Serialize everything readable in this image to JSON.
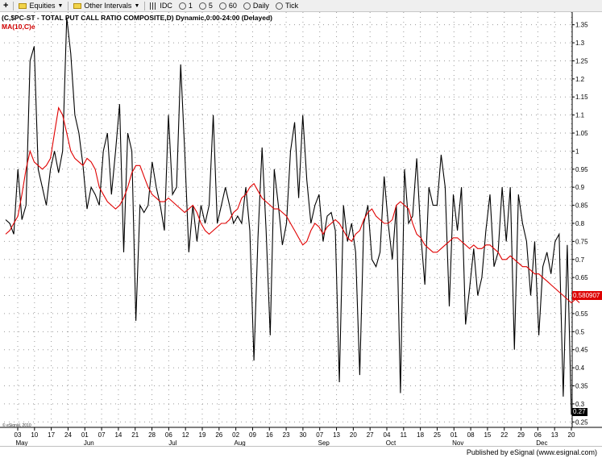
{
  "toolbar": {
    "items": [
      {
        "label": "Equities",
        "icon": "folder-icon",
        "dropdown": true
      },
      {
        "label": "Other Intervals",
        "icon": "folder-icon",
        "dropdown": true
      },
      {
        "label": "IDC",
        "icon": "interval-icon"
      },
      {
        "label": "1",
        "icon": "interval-icon"
      },
      {
        "label": "5",
        "icon": "interval-icon"
      },
      {
        "label": "60",
        "icon": "interval-icon"
      },
      {
        "label": "Daily",
        "icon": "interval-icon"
      },
      {
        "label": "Tick",
        "icon": "interval-icon"
      }
    ]
  },
  "footer": {
    "credit": "Published by eSignal (www.esignal.com)"
  },
  "watermark": "© eSignal, 2010",
  "chart_data": {
    "type": "line",
    "title": "(C,$PC-ST - TOTAL PUT CALL RATIO COMPOSITE,D) Dynamic,0:00-24:00 (Delayed)",
    "ma_label": "MA(10,C)e",
    "colors": {
      "price": "#000000",
      "ma": "#e00000",
      "grid": "#9a9a9a"
    },
    "ylim": [
      0.235,
      1.385
    ],
    "y_ticks": [
      0.25,
      0.3,
      0.35,
      0.4,
      0.45,
      0.5,
      0.55,
      0.6,
      0.65,
      0.7,
      0.75,
      0.8,
      0.85,
      0.9,
      0.95,
      1,
      1.05,
      1.1,
      1.15,
      1.2,
      1.25,
      1.3,
      1.35
    ],
    "x_tick_labels": [
      "03",
      "10",
      "17",
      "24",
      "01",
      "07",
      "14",
      "21",
      "28",
      "06",
      "12",
      "19",
      "26",
      "02",
      "09",
      "16",
      "23",
      "30",
      "07",
      "13",
      "20",
      "27",
      "04",
      "11",
      "18",
      "25",
      "01",
      "08",
      "15",
      "22",
      "29",
      "06",
      "13",
      "20"
    ],
    "month_labels": [
      {
        "label": "May",
        "tick": 0
      },
      {
        "label": "Jun",
        "tick": 4
      },
      {
        "label": "Jul",
        "tick": 9
      },
      {
        "label": "Aug",
        "tick": 13
      },
      {
        "label": "Sep",
        "tick": 18
      },
      {
        "label": "Oct",
        "tick": 22
      },
      {
        "label": "Nov",
        "tick": 26
      },
      {
        "label": "Dec",
        "tick": 31
      }
    ],
    "last_value_labels": {
      "ma": "0.580907",
      "close": "0.27"
    },
    "series": [
      {
        "name": "Close",
        "values": [
          0.81,
          0.8,
          0.77,
          0.95,
          0.81,
          0.85,
          1.25,
          1.29,
          0.95,
          0.9,
          0.85,
          0.95,
          1,
          0.94,
          1,
          1.37,
          1.27,
          1.1,
          1.05,
          0.96,
          0.84,
          0.9,
          0.88,
          0.85,
          1,
          1.05,
          0.88,
          1,
          1.13,
          0.72,
          1.05,
          1,
          0.53,
          0.85,
          0.83,
          0.85,
          0.97,
          0.9,
          0.85,
          0.78,
          1.1,
          0.88,
          0.9,
          1.24,
          1,
          0.72,
          0.85,
          0.75,
          0.85,
          0.8,
          0.85,
          1.1,
          0.8,
          0.85,
          0.9,
          0.85,
          0.8,
          0.82,
          0.8,
          0.9,
          0.78,
          0.42,
          0.76,
          1.01,
          0.78,
          0.49,
          0.95,
          0.85,
          0.74,
          0.8,
          1,
          1.08,
          0.87,
          1.1,
          0.92,
          0.8,
          0.85,
          0.88,
          0.75,
          0.82,
          0.83,
          0.78,
          0.36,
          0.85,
          0.75,
          0.8,
          0.72,
          0.38,
          0.8,
          0.85,
          0.7,
          0.68,
          0.72,
          0.93,
          0.8,
          0.7,
          0.85,
          0.33,
          0.95,
          0.8,
          0.82,
          0.98,
          0.77,
          0.63,
          0.9,
          0.85,
          0.85,
          0.99,
          0.9,
          0.57,
          0.88,
          0.78,
          0.9,
          0.52,
          0.62,
          0.73,
          0.6,
          0.65,
          0.78,
          0.88,
          0.68,
          0.72,
          0.9,
          0.75,
          0.9,
          0.45,
          0.88,
          0.8,
          0.75,
          0.6,
          0.75,
          0.49,
          0.68,
          0.72,
          0.66,
          0.75,
          0.77,
          0.32,
          0.74,
          0.27
        ]
      },
      {
        "name": "MA(10,C)e",
        "values": [
          0.77,
          0.78,
          0.8,
          0.82,
          0.88,
          0.95,
          1,
          0.97,
          0.96,
          0.95,
          0.96,
          0.98,
          1.05,
          1.12,
          1.1,
          1.05,
          1,
          0.98,
          0.97,
          0.96,
          0.98,
          0.97,
          0.95,
          0.9,
          0.88,
          0.86,
          0.85,
          0.84,
          0.85,
          0.87,
          0.9,
          0.94,
          0.96,
          0.96,
          0.93,
          0.9,
          0.88,
          0.87,
          0.86,
          0.86,
          0.87,
          0.86,
          0.85,
          0.84,
          0.83,
          0.84,
          0.85,
          0.83,
          0.8,
          0.78,
          0.77,
          0.78,
          0.79,
          0.8,
          0.8,
          0.81,
          0.83,
          0.84,
          0.87,
          0.88,
          0.9,
          0.91,
          0.89,
          0.87,
          0.86,
          0.85,
          0.84,
          0.84,
          0.83,
          0.82,
          0.8,
          0.78,
          0.76,
          0.74,
          0.75,
          0.78,
          0.8,
          0.79,
          0.77,
          0.79,
          0.8,
          0.81,
          0.8,
          0.78,
          0.76,
          0.75,
          0.77,
          0.78,
          0.81,
          0.83,
          0.84,
          0.82,
          0.81,
          0.8,
          0.8,
          0.81,
          0.85,
          0.86,
          0.85,
          0.84,
          0.8,
          0.77,
          0.76,
          0.74,
          0.73,
          0.72,
          0.72,
          0.73,
          0.74,
          0.75,
          0.76,
          0.76,
          0.75,
          0.74,
          0.73,
          0.74,
          0.73,
          0.73,
          0.74,
          0.74,
          0.73,
          0.72,
          0.7,
          0.7,
          0.71,
          0.7,
          0.69,
          0.68,
          0.68,
          0.67,
          0.66,
          0.66,
          0.65,
          0.64,
          0.63,
          0.62,
          0.61,
          0.6,
          0.59,
          0.58,
          0.59,
          0.58
        ]
      }
    ]
  }
}
